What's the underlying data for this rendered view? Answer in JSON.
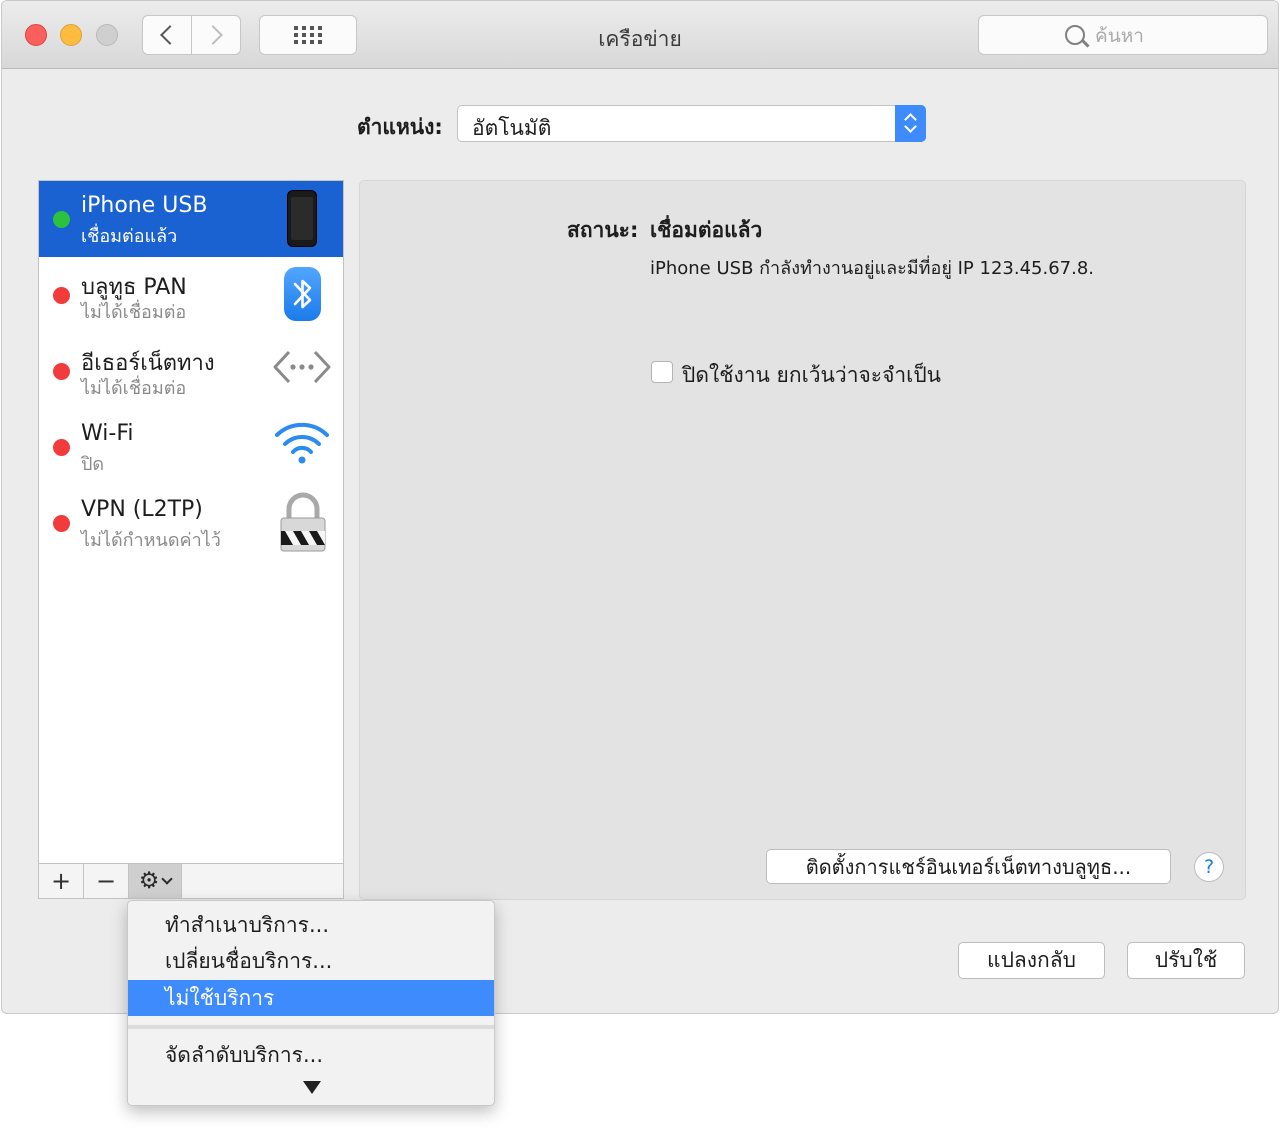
{
  "window": {
    "title": "เครือข่าย",
    "search_placeholder": "ค้นหา"
  },
  "location": {
    "label": "ตำแหน่ง:",
    "value": "อัตโนมัติ"
  },
  "services": [
    {
      "name": "iPhone USB",
      "status": "เชื่อมต่อแล้ว",
      "state_color": "#2dc23e",
      "icon": "iphone-icon",
      "selected": true
    },
    {
      "name": "บลูทูธ PAN",
      "status": "ไม่ได้เชื่อมต่อ",
      "state_color": "#f23c3c",
      "icon": "bluetooth-icon",
      "selected": false
    },
    {
      "name": "อีเธอร์เน็ตทาง",
      "status": "ไม่ได้เชื่อมต่อ",
      "state_color": "#f23c3c",
      "icon": "ethernet-icon",
      "selected": false
    },
    {
      "name": "Wi-Fi",
      "status": "ปิด",
      "state_color": "#f23c3c",
      "icon": "wifi-icon",
      "selected": false
    },
    {
      "name": "VPN (L2TP)",
      "status": "ไม่ได้กำหนดค่าไว้",
      "state_color": "#f23c3c",
      "icon": "lock-icon",
      "selected": false
    }
  ],
  "toolbar": {
    "add": "+",
    "remove": "−",
    "gear": "⚙"
  },
  "detail": {
    "status_label": "สถานะ:",
    "status_value": "เชื่อมต่อแล้ว",
    "status_desc": "iPhone USB  กำลังทำงานอยู่และมีที่อยู่ IP 123.45.67.8.",
    "disable_checkbox_label": "ปิดใช้งาน ยกเว้นว่าจะจำเป็น",
    "disable_checkbox_checked": false,
    "bt_share_button": "ติดตั้งการแชร์อินเทอร์เน็ตทางบลูทูธ...",
    "help": "?"
  },
  "buttons": {
    "revert": "แปลงกลับ",
    "apply": "ปรับใช้"
  },
  "gear_menu": {
    "items": [
      "ทำสำเนาบริการ...",
      "เปลี่ยนชื่อบริการ...",
      "ไม่ใช้บริการ",
      "จัดลำดับบริการ..."
    ],
    "highlighted_index": 2
  },
  "colors": {
    "selection": "#1a62d1",
    "menu_highlight": "#3d8bfd",
    "connected": "#2dc23e",
    "disconnected": "#f23c3c"
  }
}
